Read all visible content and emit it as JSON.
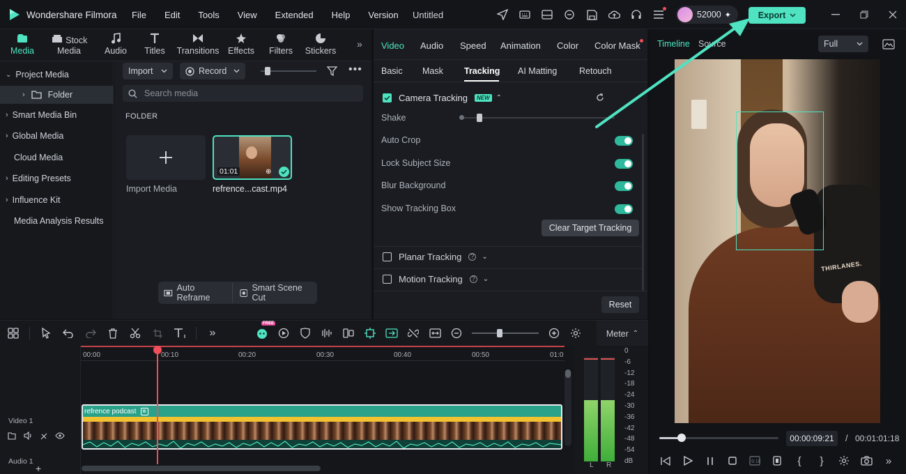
{
  "app": {
    "name": "Wondershare Filmora",
    "project_title": "Untitled",
    "credits": "52000",
    "export_label": "Export"
  },
  "menu": [
    "File",
    "Edit",
    "Tools",
    "View",
    "Extended",
    "Help",
    "Version"
  ],
  "media_tabs": [
    {
      "label": "Media",
      "icon": "media-icon"
    },
    {
      "label": "Stock Media",
      "icon": "stock-media-icon"
    },
    {
      "label": "Audio",
      "icon": "audio-icon"
    },
    {
      "label": "Titles",
      "icon": "titles-icon"
    },
    {
      "label": "Transitions",
      "icon": "transitions-icon"
    },
    {
      "label": "Effects",
      "icon": "effects-icon"
    },
    {
      "label": "Filters",
      "icon": "filters-icon"
    },
    {
      "label": "Stickers",
      "icon": "stickers-icon"
    }
  ],
  "sidebar": {
    "items": [
      "Project Media",
      "Folder",
      "Smart Media Bin",
      "Global Media",
      "Cloud Media",
      "Editing Presets",
      "Influence Kit",
      "Media Analysis Results"
    ]
  },
  "media": {
    "import_label": "Import",
    "record_label": "Record",
    "search_placeholder": "Search media",
    "folder_heading": "FOLDER",
    "import_media_label": "Import Media",
    "clip_name": "refrence...cast.mp4",
    "clip_duration": "01:01",
    "auto_reframe": "Auto Reframe",
    "smart_scene_cut": "Smart Scene Cut"
  },
  "props": {
    "tabs": [
      "Video",
      "Audio",
      "Speed",
      "Animation",
      "Color",
      "Color Mask"
    ],
    "subtabs": [
      "Basic",
      "Mask",
      "Tracking",
      "AI Matting",
      "Retouch"
    ],
    "camera_tracking": "Camera Tracking",
    "new_badge": "NEW",
    "shake": "Shake",
    "auto_crop": "Auto Crop",
    "lock_subject": "Lock Subject Size",
    "blur_bg": "Blur Background",
    "show_box": "Show Tracking Box",
    "clear_btn": "Clear Target Tracking",
    "planar": "Planar Tracking",
    "motion": "Motion Tracking",
    "reset": "Reset"
  },
  "player": {
    "tab_timeline": "Timeline",
    "tab_source": "Source",
    "quality": "Full",
    "current_time": "00:00:09:21",
    "separator": "/",
    "total_time": "00:01:01:18",
    "caption_text": "THIRLANES.",
    "progress": 0.19
  },
  "timeline": {
    "meter_label": "Meter",
    "ruler": [
      "00:00",
      "00:10",
      "00:20",
      "00:30",
      "00:40",
      "00:50",
      "01:0"
    ],
    "track_video": "Video 1",
    "track_audio": "Audio 1",
    "clip_label": "refrence podcast",
    "free_badge": "FREE",
    "db_scale": [
      "0",
      "-6",
      "-12",
      "-18",
      "-24",
      "-30",
      "-36",
      "-42",
      "-48",
      "-54",
      "dB"
    ],
    "meter_l": "L",
    "meter_r": "R"
  },
  "colors": {
    "accent": "#4fe3c1",
    "panel": "#1a1c21",
    "playhead": "#f04f5a",
    "clip_green": "#1f8f78"
  }
}
